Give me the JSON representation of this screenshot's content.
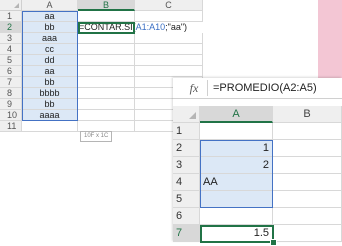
{
  "sheet1": {
    "columns": [
      "A",
      "B",
      "C"
    ],
    "rows": [
      {
        "num": "1",
        "a": "aa"
      },
      {
        "num": "2",
        "a": "bb"
      },
      {
        "num": "3",
        "a": "aaa"
      },
      {
        "num": "4",
        "a": "cc"
      },
      {
        "num": "5",
        "a": "dd"
      },
      {
        "num": "6",
        "a": "aa"
      },
      {
        "num": "7",
        "a": "bb"
      },
      {
        "num": "8",
        "a": "bbbb"
      },
      {
        "num": "9",
        "a": "bb"
      },
      {
        "num": "10",
        "a": "aaaa"
      },
      {
        "num": "11",
        "a": ""
      }
    ],
    "formula": {
      "prefix": "=CONTAR.SI(",
      "ref": "A1:A10",
      "suffix": ";\"aa\")"
    },
    "tooltip": "10F x 1C"
  },
  "sheet2": {
    "fx_label": "fx",
    "formula_bar": "=PROMEDIO(A2:A5)",
    "columns": [
      "A",
      "B"
    ],
    "rows": [
      {
        "num": "1",
        "a": ""
      },
      {
        "num": "2",
        "a": "1"
      },
      {
        "num": "3",
        "a": "2"
      },
      {
        "num": "4",
        "a": "AA"
      },
      {
        "num": "5",
        "a": ""
      },
      {
        "num": "6",
        "a": ""
      },
      {
        "num": "7",
        "a": "1.5"
      }
    ]
  },
  "colors": {
    "selection_fill": "#dce8f6",
    "range_border": "#4472c4",
    "active_border": "#217346",
    "reference_text": "#3a6fc4",
    "background_accent": "#f3c6d4"
  }
}
